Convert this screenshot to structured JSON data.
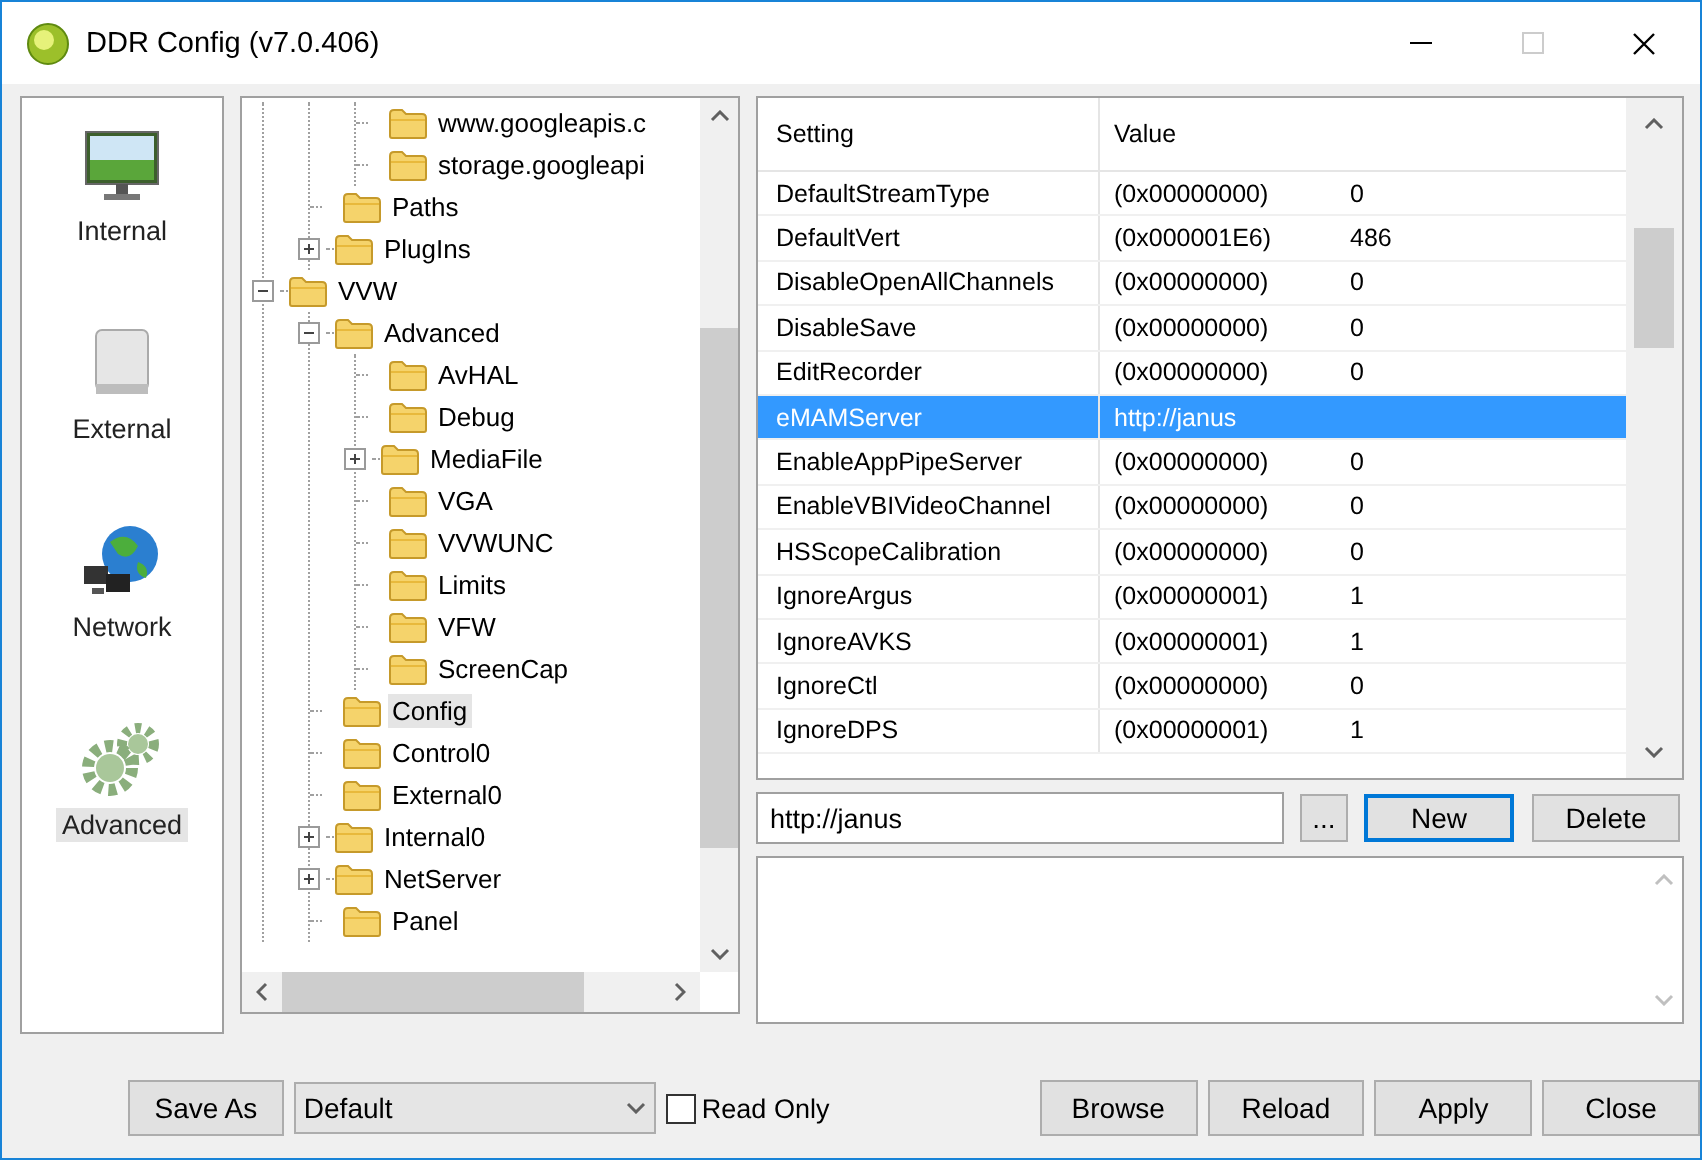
{
  "window": {
    "title": "DDR Config (v7.0.406)"
  },
  "sidebar": {
    "items": [
      {
        "label": "Internal",
        "kind": "monitor",
        "selected": false
      },
      {
        "label": "External",
        "kind": "drive",
        "selected": false
      },
      {
        "label": "Network",
        "kind": "globe",
        "selected": false
      },
      {
        "label": "Advanced",
        "kind": "gears",
        "selected": true
      }
    ]
  },
  "tree": [
    {
      "children": [
        {
          "children": [
            {
              "label": "www.googleapis.c",
              "selected": false
            },
            {
              "label": "storage.googleapi",
              "selected": false
            }
          ]
        },
        {
          "label": "Paths",
          "selected": false
        },
        {
          "label": "PlugIns",
          "expanded": false,
          "selected": false
        }
      ]
    },
    {
      "label": "VVW",
      "expanded": true,
      "selected": false,
      "children": [
        {
          "label": "Advanced",
          "expanded": true,
          "selected": false,
          "children": [
            {
              "label": "AvHAL",
              "selected": false
            },
            {
              "label": "Debug",
              "selected": false
            },
            {
              "label": "MediaFile",
              "expanded": false,
              "selected": false
            },
            {
              "label": "VGA",
              "selected": false
            },
            {
              "label": "VVWUNC",
              "selected": false
            },
            {
              "label": "Limits",
              "selected": false
            },
            {
              "label": "VFW",
              "selected": false
            },
            {
              "label": "ScreenCap",
              "selected": false
            }
          ]
        },
        {
          "label": "Config",
          "selected": true
        },
        {
          "label": "Control0",
          "selected": false
        },
        {
          "label": "External0",
          "selected": false
        },
        {
          "label": "Internal0",
          "expanded": false,
          "selected": false
        },
        {
          "label": "NetServer",
          "expanded": false,
          "selected": false
        },
        {
          "label": "Panel",
          "selected": false
        }
      ]
    }
  ],
  "table": {
    "columns": [
      "Setting",
      "Value"
    ],
    "rows": [
      {
        "setting": "DefaultStreamType",
        "value": "(0x00000000)",
        "decimal": "0",
        "selected": false
      },
      {
        "setting": "DefaultVert",
        "value": "(0x000001E6)",
        "decimal": "486",
        "selected": false
      },
      {
        "setting": "DisableOpenAllChannels",
        "value": "(0x00000000)",
        "decimal": "0",
        "selected": false
      },
      {
        "setting": "DisableSave",
        "value": "(0x00000000)",
        "decimal": "0",
        "selected": false
      },
      {
        "setting": "EditRecorder",
        "value": "(0x00000000)",
        "decimal": "0",
        "selected": false
      },
      {
        "setting": "eMAMServer",
        "value": "http://janus",
        "selected": true
      },
      {
        "setting": "EnableAppPipeServer",
        "value": "(0x00000000)",
        "decimal": "0",
        "selected": false
      },
      {
        "setting": "EnableVBIVideoChannel",
        "value": "(0x00000000)",
        "decimal": "0",
        "selected": false
      },
      {
        "setting": "HSScopeCalibration",
        "value": "(0x00000000)",
        "decimal": "0",
        "selected": false
      },
      {
        "setting": "IgnoreArgus",
        "value": "(0x00000001)",
        "decimal": "1",
        "selected": false
      },
      {
        "setting": "IgnoreAVKS",
        "value": "(0x00000001)",
        "decimal": "1",
        "selected": false
      },
      {
        "setting": "IgnoreCtl",
        "value": "(0x00000000)",
        "decimal": "0",
        "selected": false
      },
      {
        "setting": "IgnoreDPS",
        "value": "(0x00000001)",
        "decimal": "1",
        "selected": false
      }
    ]
  },
  "editor": {
    "value": "http://janus",
    "browse_button": "...",
    "new_button": "New",
    "delete_button": "Delete"
  },
  "footer": {
    "save_as": "Save As",
    "profile": "Default",
    "read_only": {
      "label": "Read Only",
      "checked": false
    },
    "buttons": [
      "Browse",
      "Reload",
      "Apply",
      "Close"
    ]
  }
}
